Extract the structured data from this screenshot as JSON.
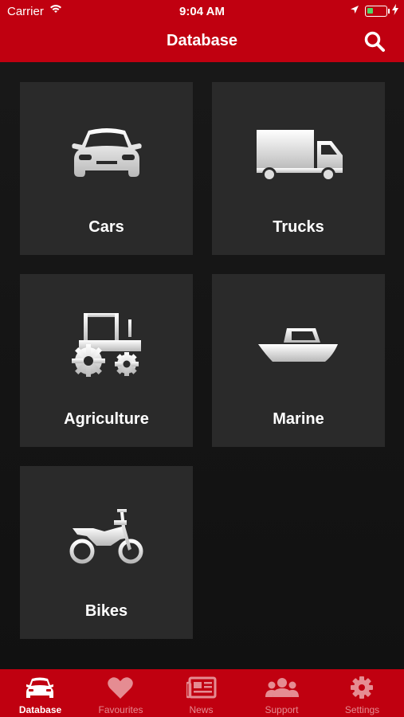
{
  "status_bar": {
    "carrier": "Carrier",
    "time": "9:04 AM",
    "battery_level_percent": 30
  },
  "header": {
    "title": "Database",
    "search_icon": "search-icon"
  },
  "categories": [
    {
      "label": "Cars",
      "icon": "car-icon"
    },
    {
      "label": "Trucks",
      "icon": "truck-icon"
    },
    {
      "label": "Agriculture",
      "icon": "tractor-icon"
    },
    {
      "label": "Marine",
      "icon": "boat-icon"
    },
    {
      "label": "Bikes",
      "icon": "motorcycle-icon"
    }
  ],
  "tabbar": {
    "items": [
      {
        "label": "Database",
        "icon": "car-icon",
        "active": true
      },
      {
        "label": "Favourites",
        "icon": "heart-icon",
        "active": false
      },
      {
        "label": "News",
        "icon": "newspaper-icon",
        "active": false
      },
      {
        "label": "Support",
        "icon": "people-icon",
        "active": false
      },
      {
        "label": "Settings",
        "icon": "gear-icon",
        "active": false
      }
    ]
  },
  "colors": {
    "brand_red": "#c00010",
    "tile_bg": "#2a2a2a",
    "inactive_tab_text": "#e58c92"
  }
}
